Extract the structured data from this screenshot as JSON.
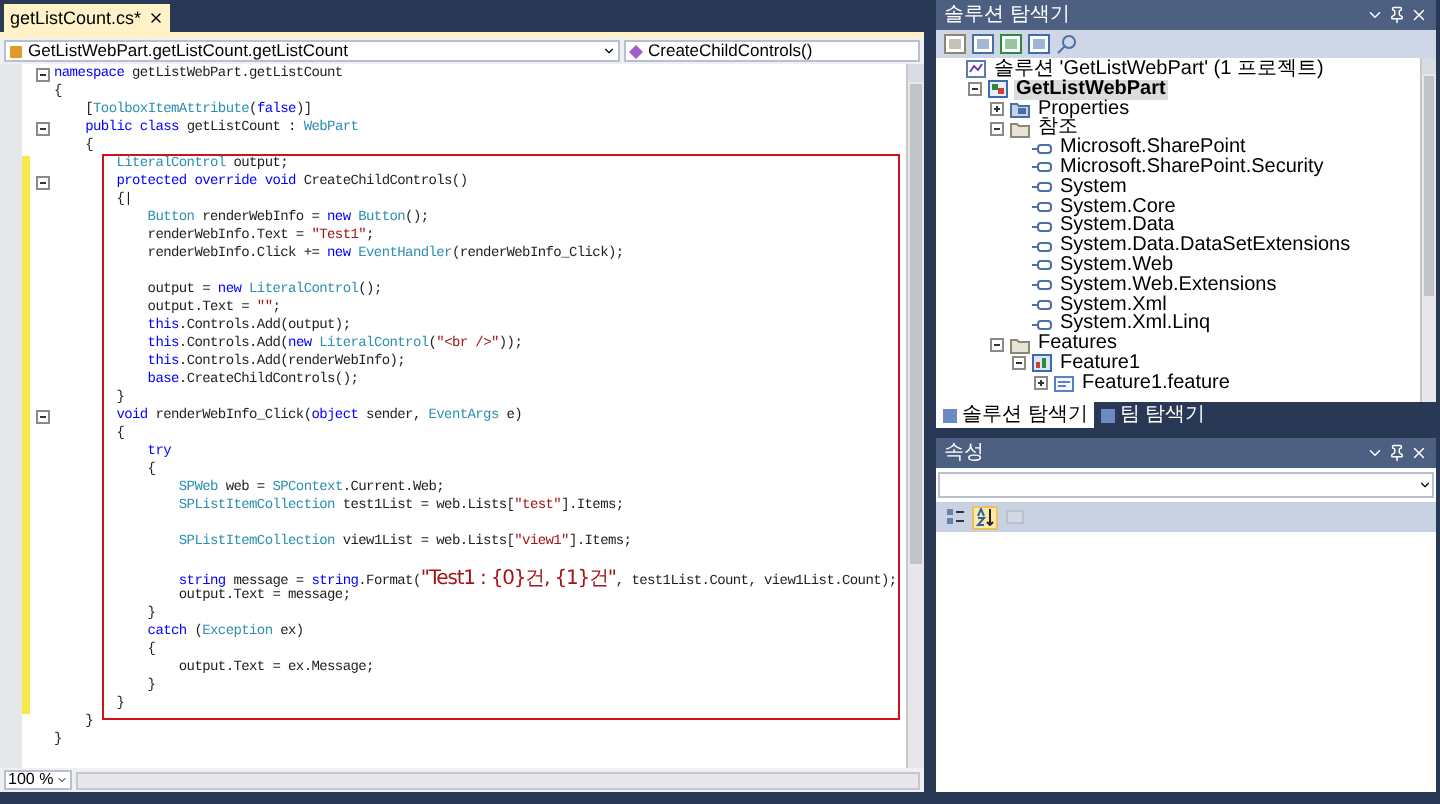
{
  "editor": {
    "tab": {
      "label": "getListCount.cs*"
    },
    "navigation": {
      "type_combo": "GetListWebPart.getListCount.getListCount",
      "member_combo": "CreateChildControls()"
    },
    "code": {
      "sections": [
        {
          "highlighted": false,
          "lines": [
            {
              "changed": false,
              "collapsible": true,
              "tokens": [
                {
                  "kind": "keyword",
                  "text": "namespace"
                },
                {
                  "kind": "plain",
                  "text": " getListWebPart.getListCount"
                }
              ]
            },
            {
              "changed": false,
              "collapsible": false,
              "tokens": [
                {
                  "kind": "plain",
                  "text": "{"
                }
              ]
            },
            {
              "changed": false,
              "collapsible": false,
              "tokens": [
                {
                  "kind": "plain",
                  "text": "    ["
                },
                {
                  "kind": "type",
                  "text": "ToolboxItemAttribute"
                },
                {
                  "kind": "plain",
                  "text": "("
                },
                {
                  "kind": "keyword",
                  "text": "false"
                },
                {
                  "kind": "plain",
                  "text": ")]"
                }
              ]
            },
            {
              "changed": false,
              "collapsible": true,
              "tokens": [
                {
                  "kind": "keyword",
                  "text": "    public class"
                },
                {
                  "kind": "plain",
                  "text": " getListCount : "
                },
                {
                  "kind": "type",
                  "text": "WebPart"
                }
              ]
            },
            {
              "changed": false,
              "collapsible": false,
              "tokens": [
                {
                  "kind": "plain",
                  "text": "    {"
                }
              ]
            }
          ]
        },
        {
          "highlighted": true,
          "lines": [
            {
              "changed": true,
              "collapsible": false,
              "tokens": [
                {
                  "kind": "type",
                  "text": "        LiteralControl"
                },
                {
                  "kind": "plain",
                  "text": " output;"
                }
              ]
            },
            {
              "changed": true,
              "collapsible": true,
              "tokens": [
                {
                  "kind": "keyword",
                  "text": "        protected override void"
                },
                {
                  "kind": "plain",
                  "text": " CreateChildControls()"
                }
              ]
            },
            {
              "changed": true,
              "collapsible": false,
              "tokens": [
                {
                  "kind": "plain",
                  "text": "        {|"
                }
              ]
            },
            {
              "changed": true,
              "collapsible": false,
              "tokens": [
                {
                  "kind": "type",
                  "text": "            Button"
                },
                {
                  "kind": "plain",
                  "text": " renderWebInfo = "
                },
                {
                  "kind": "keyword",
                  "text": "new"
                },
                {
                  "kind": "type",
                  "text": " Button"
                },
                {
                  "kind": "plain",
                  "text": "();"
                }
              ]
            },
            {
              "changed": true,
              "collapsible": false,
              "tokens": [
                {
                  "kind": "plain",
                  "text": "            renderWebInfo.Text = "
                },
                {
                  "kind": "string",
                  "text": "\"Test1\""
                },
                {
                  "kind": "plain",
                  "text": ";"
                }
              ]
            },
            {
              "changed": true,
              "collapsible": false,
              "tokens": [
                {
                  "kind": "plain",
                  "text": "            renderWebInfo.Click += "
                },
                {
                  "kind": "keyword",
                  "text": "new"
                },
                {
                  "kind": "type",
                  "text": " EventHandler"
                },
                {
                  "kind": "plain",
                  "text": "(renderWebInfo_Click);"
                }
              ]
            },
            {
              "changed": true,
              "collapsible": false
            },
            {
              "changed": true,
              "collapsible": false,
              "tokens": [
                {
                  "kind": "plain",
                  "text": "            output = "
                },
                {
                  "kind": "keyword",
                  "text": "new"
                },
                {
                  "kind": "type",
                  "text": " LiteralControl"
                },
                {
                  "kind": "plain",
                  "text": "();"
                }
              ]
            },
            {
              "changed": true,
              "collapsible": false,
              "tokens": [
                {
                  "kind": "plain",
                  "text": "            output.Text = "
                },
                {
                  "kind": "string",
                  "text": "\"\""
                },
                {
                  "kind": "plain",
                  "text": ";"
                }
              ]
            },
            {
              "changed": true,
              "collapsible": false,
              "tokens": [
                {
                  "kind": "keyword",
                  "text": "            this"
                },
                {
                  "kind": "plain",
                  "text": ".Controls.Add(output);"
                }
              ]
            },
            {
              "changed": true,
              "collapsible": false,
              "tokens": [
                {
                  "kind": "keyword",
                  "text": "            this"
                },
                {
                  "kind": "plain",
                  "text": ".Controls.Add("
                },
                {
                  "kind": "keyword",
                  "text": "new"
                },
                {
                  "kind": "type",
                  "text": " LiteralControl"
                },
                {
                  "kind": "plain",
                  "text": "("
                },
                {
                  "kind": "string",
                  "text": "\"<br />\""
                },
                {
                  "kind": "plain",
                  "text": "));"
                }
              ]
            },
            {
              "changed": true,
              "collapsible": false,
              "tokens": [
                {
                  "kind": "keyword",
                  "text": "            this"
                },
                {
                  "kind": "plain",
                  "text": ".Controls.Add(renderWebInfo);"
                }
              ]
            },
            {
              "changed": true,
              "collapsible": false,
              "tokens": [
                {
                  "kind": "keyword",
                  "text": "            base"
                },
                {
                  "kind": "plain",
                  "text": ".CreateChildControls();"
                }
              ]
            },
            {
              "changed": true,
              "collapsible": false,
              "tokens": [
                {
                  "kind": "plain",
                  "text": "        }"
                }
              ]
            },
            {
              "changed": true,
              "collapsible": true,
              "tokens": [
                {
                  "kind": "keyword",
                  "text": "        void"
                },
                {
                  "kind": "plain",
                  "text": " renderWebInfo_Click("
                },
                {
                  "kind": "keyword",
                  "text": "object"
                },
                {
                  "kind": "plain",
                  "text": " sender, "
                },
                {
                  "kind": "type",
                  "text": "EventArgs"
                },
                {
                  "kind": "plain",
                  "text": " e)"
                }
              ]
            },
            {
              "changed": true,
              "collapsible": false,
              "tokens": [
                {
                  "kind": "plain",
                  "text": "        {"
                }
              ]
            },
            {
              "changed": true,
              "collapsible": false,
              "tokens": [
                {
                  "kind": "keyword",
                  "text": "            try"
                }
              ]
            },
            {
              "changed": true,
              "collapsible": false,
              "tokens": [
                {
                  "kind": "plain",
                  "text": "            {"
                }
              ]
            },
            {
              "changed": true,
              "collapsible": false,
              "tokens": [
                {
                  "kind": "type",
                  "text": "                SPWeb"
                },
                {
                  "kind": "plain",
                  "text": " web = "
                },
                {
                  "kind": "type",
                  "text": "SPContext"
                },
                {
                  "kind": "plain",
                  "text": ".Current.Web;"
                }
              ]
            },
            {
              "changed": true,
              "collapsible": false,
              "tokens": [
                {
                  "kind": "type",
                  "text": "                SPListItemCollection"
                },
                {
                  "kind": "plain",
                  "text": " test1List = web.Lists["
                },
                {
                  "kind": "string",
                  "text": "\"test\""
                },
                {
                  "kind": "plain",
                  "text": "].Items;"
                }
              ]
            },
            {
              "changed": true,
              "collapsible": false
            },
            {
              "changed": true,
              "collapsible": false,
              "tokens": [
                {
                  "kind": "type",
                  "text": "                SPListItemCollection"
                },
                {
                  "kind": "plain",
                  "text": " view1List = web.Lists["
                },
                {
                  "kind": "string",
                  "text": "\"view1\""
                },
                {
                  "kind": "plain",
                  "text": "].Items;"
                }
              ]
            },
            {
              "changed": true,
              "collapsible": false
            },
            {
              "changed": true,
              "collapsible": false,
              "tokens": [
                {
                  "kind": "keyword",
                  "text": "                string"
                },
                {
                  "kind": "plain",
                  "text": " message = "
                },
                {
                  "kind": "keyword",
                  "text": "string"
                },
                {
                  "kind": "plain",
                  "text": ".Format("
                },
                {
                  "kind": "string",
                  "text": "\"Test1 : {0}건, {1}건\""
                },
                {
                  "kind": "plain",
                  "text": ", test1List.Count, view1List.Count);"
                }
              ]
            },
            {
              "changed": true,
              "collapsible": false,
              "tokens": [
                {
                  "kind": "plain",
                  "text": "                output.Text = message;"
                }
              ]
            },
            {
              "changed": true,
              "collapsible": false,
              "tokens": [
                {
                  "kind": "plain",
                  "text": "            }"
                }
              ]
            },
            {
              "changed": true,
              "collapsible": false,
              "tokens": [
                {
                  "kind": "keyword",
                  "text": "            catch"
                },
                {
                  "kind": "plain",
                  "text": " ("
                },
                {
                  "kind": "type",
                  "text": "Exception"
                },
                {
                  "kind": "plain",
                  "text": " ex)"
                }
              ]
            },
            {
              "changed": true,
              "collapsible": false,
              "tokens": [
                {
                  "kind": "plain",
                  "text": "            {"
                }
              ]
            },
            {
              "changed": true,
              "collapsible": false,
              "tokens": [
                {
                  "kind": "plain",
                  "text": "                output.Text = ex.Message;"
                }
              ]
            },
            {
              "changed": true,
              "collapsible": false,
              "tokens": [
                {
                  "kind": "plain",
                  "text": "            }"
                }
              ]
            },
            {
              "changed": true,
              "collapsible": false,
              "tokens": [
                {
                  "kind": "plain",
                  "text": "        }"
                }
              ]
            }
          ]
        },
        {
          "highlighted": false,
          "lines": [
            {
              "changed": false,
              "collapsible": false,
              "tokens": [
                {
                  "kind": "plain",
                  "text": "    }"
                }
              ]
            },
            {
              "changed": false,
              "collapsible": false,
              "tokens": [
                {
                  "kind": "plain",
                  "text": "}"
                }
              ]
            }
          ]
        }
      ]
    },
    "zoom": "100 %"
  },
  "solution_explorer": {
    "title": "솔루션 탐색기",
    "tree": [
      {
        "kind": "solution",
        "label": "솔루션 'GetListWebPart' (1 프로젝트)",
        "selected": false,
        "children": [
          {
            "kind": "project",
            "label": "GetListWebPart",
            "selected": true,
            "expanded": true,
            "children": [
              {
                "kind": "properties",
                "label": "Properties",
                "selected": false,
                "expanded": false
              },
              {
                "kind": "folder",
                "label": "참조",
                "selected": false,
                "expanded": true,
                "children": [
                  {
                    "kind": "reference",
                    "label": "Microsoft.SharePoint",
                    "selected": false
                  },
                  {
                    "kind": "reference",
                    "label": "Microsoft.SharePoint.Security",
                    "selected": false
                  },
                  {
                    "kind": "reference",
                    "label": "System",
                    "selected": false
                  },
                  {
                    "kind": "reference",
                    "label": "System.Core",
                    "selected": false
                  },
                  {
                    "kind": "reference",
                    "label": "System.Data",
                    "selected": false
                  },
                  {
                    "kind": "reference",
                    "label": "System.Data.DataSetExtensions",
                    "selected": false
                  },
                  {
                    "kind": "reference",
                    "label": "System.Web",
                    "selected": false
                  },
                  {
                    "kind": "reference",
                    "label": "System.Web.Extensions",
                    "selected": false
                  },
                  {
                    "kind": "reference",
                    "label": "System.Xml",
                    "selected": false
                  },
                  {
                    "kind": "reference",
                    "label": "System.Xml.Linq",
                    "selected": false
                  }
                ]
              },
              {
                "kind": "folder",
                "label": "Features",
                "selected": false,
                "expanded": true,
                "children": [
                  {
                    "kind": "feature",
                    "label": "Feature1",
                    "selected": false,
                    "expanded": true,
                    "children": [
                      {
                        "kind": "feature-file",
                        "label": "Feature1.feature",
                        "selected": false,
                        "expanded": false
                      }
                    ]
                  }
                ]
              }
            ]
          }
        ]
      }
    ],
    "tabs": [
      {
        "label": "솔루션 탐색기",
        "selected": true
      },
      {
        "label": "팀 탐색기",
        "selected": false
      }
    ]
  },
  "properties": {
    "title": "속성",
    "toolbar": [
      {
        "kind": "categorized",
        "selected": false,
        "disabled": false
      },
      {
        "kind": "alphabetical",
        "selected": true,
        "disabled": false
      },
      {
        "kind": "pages",
        "selected": false,
        "disabled": true
      }
    ]
  }
}
